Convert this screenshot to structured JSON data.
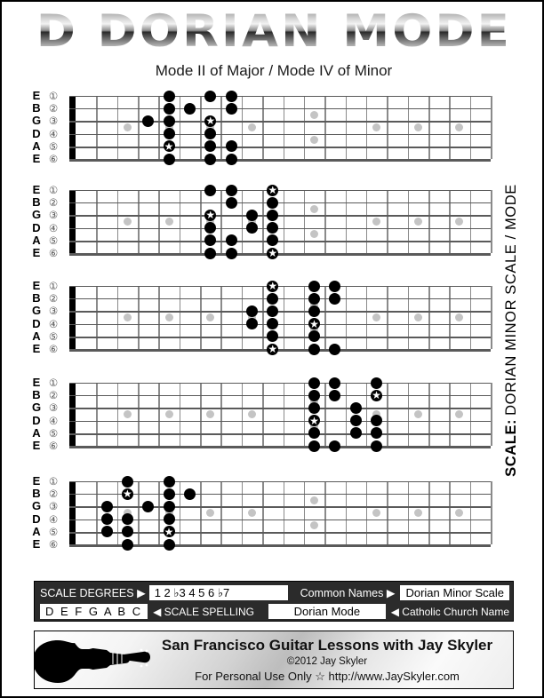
{
  "title": "D DORIAN MODE",
  "subtitle": "Mode II of Major / Mode IV of Minor",
  "vertical_label": {
    "bold": "SCALE:",
    "rest": "DORIAN MINOR SCALE / MODE"
  },
  "string_names": [
    "E",
    "B",
    "G",
    "D",
    "A",
    "E"
  ],
  "string_numbers": [
    "①",
    "②",
    "③",
    "④",
    "⑤",
    "⑥"
  ],
  "inlay_frets": [
    3,
    5,
    7,
    9,
    12,
    15,
    17,
    19
  ],
  "double_inlay_frets": [
    12
  ],
  "legend": {
    "scale_degrees_label": "SCALE DEGREES ▶",
    "scale_degrees_value": "1 2 ♭3 4 5 6 ♭7",
    "common_names_label": "Common Names ▶",
    "common_names_value": "Dorian Minor Scale",
    "scale_spelling_value": "D E F G A B C",
    "scale_spelling_label": "◀ SCALE SPELLING",
    "church_name_value": "Dorian Mode",
    "church_name_label": "◀ Catholic Church Name"
  },
  "footer": {
    "line1": "San Francisco Guitar Lessons with Jay Skyler",
    "line2": "©2012 Jay Skyler",
    "line3": "For Personal Use Only  ☆  http://www.JaySkyler.com"
  },
  "diagrams": [
    {
      "position": 1,
      "notes": [
        {
          "string": 3,
          "fret": 4,
          "root": false
        },
        {
          "string": 1,
          "fret": 5,
          "root": false
        },
        {
          "string": 2,
          "fret": 5,
          "root": false
        },
        {
          "string": 3,
          "fret": 5,
          "root": false
        },
        {
          "string": 4,
          "fret": 5,
          "root": false
        },
        {
          "string": 5,
          "fret": 5,
          "root": true
        },
        {
          "string": 6,
          "fret": 5,
          "root": false
        },
        {
          "string": 2,
          "fret": 6,
          "root": false
        },
        {
          "string": 1,
          "fret": 7,
          "root": false
        },
        {
          "string": 3,
          "fret": 7,
          "root": true
        },
        {
          "string": 4,
          "fret": 7,
          "root": false
        },
        {
          "string": 5,
          "fret": 7,
          "root": false
        },
        {
          "string": 6,
          "fret": 7,
          "root": false
        },
        {
          "string": 1,
          "fret": 8,
          "root": false
        },
        {
          "string": 2,
          "fret": 8,
          "root": false
        },
        {
          "string": 5,
          "fret": 8,
          "root": false
        },
        {
          "string": 6,
          "fret": 8,
          "root": false
        }
      ]
    },
    {
      "position": 2,
      "notes": [
        {
          "string": 1,
          "fret": 7,
          "root": false
        },
        {
          "string": 3,
          "fret": 7,
          "root": true
        },
        {
          "string": 4,
          "fret": 7,
          "root": false
        },
        {
          "string": 5,
          "fret": 7,
          "root": false
        },
        {
          "string": 6,
          "fret": 7,
          "root": false
        },
        {
          "string": 1,
          "fret": 8,
          "root": false
        },
        {
          "string": 2,
          "fret": 8,
          "root": false
        },
        {
          "string": 5,
          "fret": 8,
          "root": false
        },
        {
          "string": 6,
          "fret": 8,
          "root": false
        },
        {
          "string": 3,
          "fret": 9,
          "root": false
        },
        {
          "string": 4,
          "fret": 9,
          "root": false
        },
        {
          "string": 1,
          "fret": 10,
          "root": true
        },
        {
          "string": 2,
          "fret": 10,
          "root": false
        },
        {
          "string": 3,
          "fret": 10,
          "root": false
        },
        {
          "string": 4,
          "fret": 10,
          "root": false
        },
        {
          "string": 5,
          "fret": 10,
          "root": false
        },
        {
          "string": 6,
          "fret": 10,
          "root": true
        }
      ]
    },
    {
      "position": 3,
      "notes": [
        {
          "string": 3,
          "fret": 9,
          "root": false
        },
        {
          "string": 4,
          "fret": 9,
          "root": false
        },
        {
          "string": 1,
          "fret": 10,
          "root": true
        },
        {
          "string": 2,
          "fret": 10,
          "root": false
        },
        {
          "string": 3,
          "fret": 10,
          "root": false
        },
        {
          "string": 4,
          "fret": 10,
          "root": false
        },
        {
          "string": 5,
          "fret": 10,
          "root": false
        },
        {
          "string": 6,
          "fret": 10,
          "root": true
        },
        {
          "string": 1,
          "fret": 12,
          "root": false
        },
        {
          "string": 2,
          "fret": 12,
          "root": false
        },
        {
          "string": 3,
          "fret": 12,
          "root": false
        },
        {
          "string": 4,
          "fret": 12,
          "root": true
        },
        {
          "string": 5,
          "fret": 12,
          "root": false
        },
        {
          "string": 6,
          "fret": 12,
          "root": false
        },
        {
          "string": 1,
          "fret": 13,
          "root": false
        },
        {
          "string": 2,
          "fret": 13,
          "root": false
        },
        {
          "string": 6,
          "fret": 13,
          "root": false
        }
      ]
    },
    {
      "position": 4,
      "notes": [
        {
          "string": 1,
          "fret": 12,
          "root": false
        },
        {
          "string": 2,
          "fret": 12,
          "root": false
        },
        {
          "string": 3,
          "fret": 12,
          "root": false
        },
        {
          "string": 4,
          "fret": 12,
          "root": true
        },
        {
          "string": 5,
          "fret": 12,
          "root": false
        },
        {
          "string": 6,
          "fret": 12,
          "root": false
        },
        {
          "string": 1,
          "fret": 13,
          "root": false
        },
        {
          "string": 2,
          "fret": 13,
          "root": false
        },
        {
          "string": 6,
          "fret": 13,
          "root": false
        },
        {
          "string": 3,
          "fret": 14,
          "root": false
        },
        {
          "string": 4,
          "fret": 14,
          "root": false
        },
        {
          "string": 5,
          "fret": 14,
          "root": false
        },
        {
          "string": 1,
          "fret": 15,
          "root": false
        },
        {
          "string": 2,
          "fret": 15,
          "root": true
        },
        {
          "string": 4,
          "fret": 15,
          "root": false
        },
        {
          "string": 5,
          "fret": 15,
          "root": false
        },
        {
          "string": 6,
          "fret": 15,
          "root": false
        }
      ]
    },
    {
      "position": 5,
      "notes": [
        {
          "string": 3,
          "fret": 2,
          "root": false
        },
        {
          "string": 4,
          "fret": 2,
          "root": false
        },
        {
          "string": 5,
          "fret": 2,
          "root": false
        },
        {
          "string": 1,
          "fret": 3,
          "root": false
        },
        {
          "string": 2,
          "fret": 3,
          "root": true
        },
        {
          "string": 4,
          "fret": 3,
          "root": false
        },
        {
          "string": 5,
          "fret": 3,
          "root": false
        },
        {
          "string": 6,
          "fret": 3,
          "root": false
        },
        {
          "string": 3,
          "fret": 4,
          "root": false
        },
        {
          "string": 1,
          "fret": 5,
          "root": false
        },
        {
          "string": 2,
          "fret": 5,
          "root": false
        },
        {
          "string": 3,
          "fret": 5,
          "root": false
        },
        {
          "string": 4,
          "fret": 5,
          "root": false
        },
        {
          "string": 5,
          "fret": 5,
          "root": true
        },
        {
          "string": 6,
          "fret": 5,
          "root": false
        },
        {
          "string": 2,
          "fret": 6,
          "root": false
        }
      ]
    }
  ]
}
